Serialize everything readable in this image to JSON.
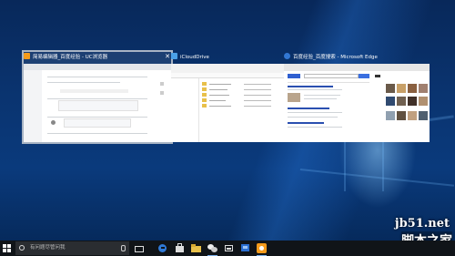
{
  "windows": [
    {
      "title": "简易编辑器_百度经验 - UC浏览器",
      "icon_color": "#f59b1b"
    },
    {
      "title": "iCloudDrive",
      "icon_color": "#4aa0e8"
    },
    {
      "title": "百度经验_百度搜索 - Microsoft Edge",
      "icon_color": "#3277d3"
    }
  ],
  "taskbar": {
    "search_placeholder": "有问题尽管问我",
    "icons": [
      "cortana-circle",
      "task-view-icon",
      "edge-icon",
      "store-icon",
      "explorer-icon",
      "wechat-icon",
      "photos-icon",
      "monitor-icon",
      "uc-browser-icon"
    ]
  },
  "watermark": {
    "site": "jb51.net",
    "text": "脚本之家"
  }
}
